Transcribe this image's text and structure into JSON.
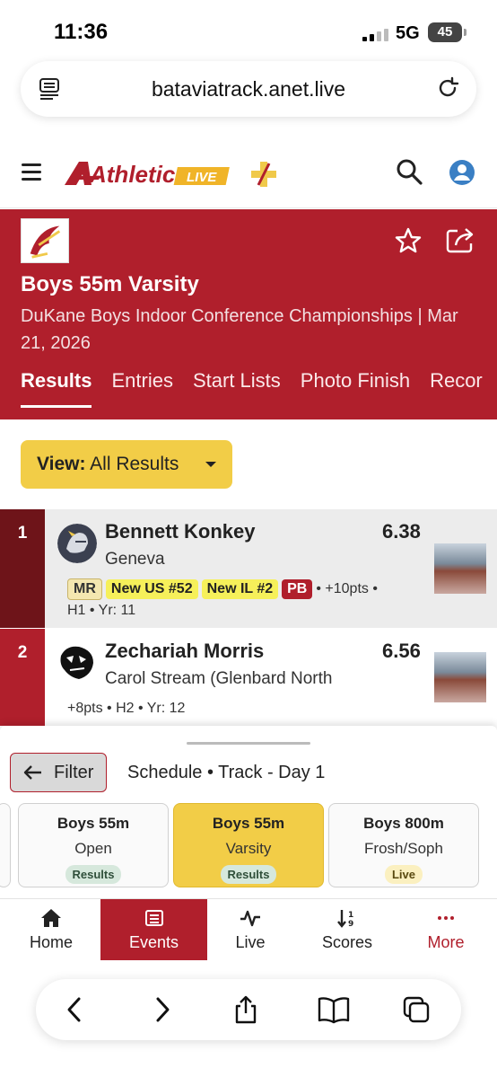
{
  "status_bar": {
    "time": "11:36",
    "network": "5G",
    "battery": "45"
  },
  "browser": {
    "url": "bataviatrack.anet.live"
  },
  "site": {
    "logo_text": "Athletic",
    "logo_badge": "LIVE"
  },
  "event": {
    "title": "Boys 55m Varsity",
    "meet": "DuKane Boys Indoor Conference Championships | Mar 21, 2026",
    "tabs": [
      "Results",
      "Entries",
      "Start Lists",
      "Photo Finish",
      "Recor"
    ]
  },
  "view": {
    "label": "View:",
    "value": "All Results"
  },
  "results": [
    {
      "place": "1",
      "name": "Bennett Konkey",
      "mark": "6.38",
      "team": "Geneva",
      "badges": [
        "MR",
        "New US #52",
        "New IL #2",
        "PB"
      ],
      "points": "• +10pts •",
      "heat_year": "H1 • Yr: 11"
    },
    {
      "place": "2",
      "name": "Zechariah Morris",
      "mark": "6.56",
      "team": "Carol Stream (Glenbard North",
      "details": "+8pts • H2 • Yr: 12"
    }
  ],
  "sheet": {
    "filter_label": "Filter",
    "schedule": "Schedule • Track - Day 1",
    "cards": [
      {
        "event": "Boys 55m",
        "division": "Open",
        "status": "Results"
      },
      {
        "event": "Boys 55m",
        "division": "Varsity",
        "status": "Results"
      },
      {
        "event": "Boys 800m",
        "division": "Frosh/Soph",
        "status": "Live"
      }
    ]
  },
  "bottom_nav": [
    "Home",
    "Events",
    "Live",
    "Scores",
    "More"
  ],
  "colors": {
    "brand_red": "#b01f2c",
    "accent_yellow": "#f2cd47"
  }
}
